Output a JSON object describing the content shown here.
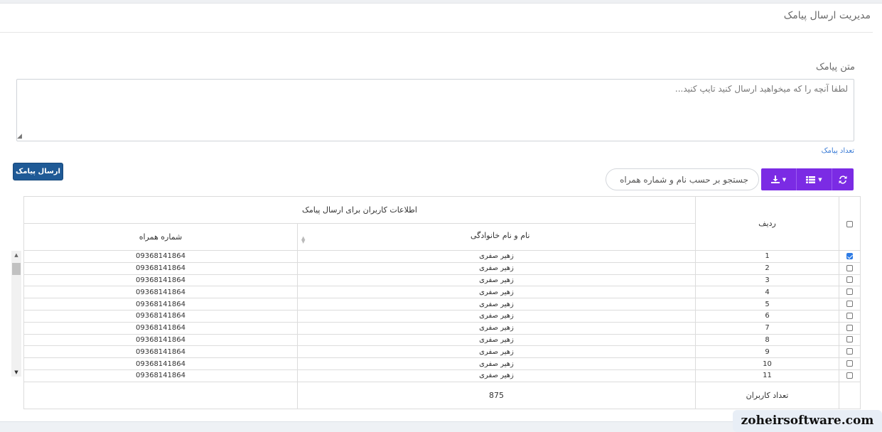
{
  "page": {
    "title": "مدیریت ارسال پیامک"
  },
  "message": {
    "label": "متن پیامک",
    "placeholder": "لطفا آنچه را که میخواهید ارسال کنید تایپ کنید...",
    "count_label": "تعداد پیامک",
    "send_label": "ارسال پیامک"
  },
  "search": {
    "placeholder": "جستجو بر حسب نام و شماره همراه"
  },
  "toolbar": {
    "icons": [
      "download-icon",
      "columns-icon",
      "refresh-icon"
    ],
    "color": "#7b2be4"
  },
  "table": {
    "group_header": "اطلاعات کاربران برای ارسال پیامک",
    "col_row": "ردیف",
    "col_name": "نام و نام خانوادگی",
    "col_phone": "شماره همراه",
    "rows": [
      {
        "index": "1",
        "name": "زهیر صفری",
        "phone": "09368141864",
        "checked": true
      },
      {
        "index": "2",
        "name": "زهیر صفری",
        "phone": "09368141864",
        "checked": false
      },
      {
        "index": "3",
        "name": "زهیر صفری",
        "phone": "09368141864",
        "checked": false
      },
      {
        "index": "4",
        "name": "زهیر صفری",
        "phone": "09368141864",
        "checked": false
      },
      {
        "index": "5",
        "name": "زهیر صفری",
        "phone": "09368141864",
        "checked": false
      },
      {
        "index": "6",
        "name": "زهیر صفری",
        "phone": "09368141864",
        "checked": false
      },
      {
        "index": "7",
        "name": "زهیر صفری",
        "phone": "09368141864",
        "checked": false
      },
      {
        "index": "8",
        "name": "زهیر صفری",
        "phone": "09368141864",
        "checked": false
      },
      {
        "index": "9",
        "name": "زهیر صفری",
        "phone": "09368141864",
        "checked": false
      },
      {
        "index": "10",
        "name": "زهیر صفری",
        "phone": "09368141864",
        "checked": false
      },
      {
        "index": "11",
        "name": "زهیر صفری",
        "phone": "09368141864",
        "checked": false
      }
    ],
    "footer_label": "تعداد کاربران",
    "footer_value": "875"
  },
  "watermark": "zoheirsoftware.com"
}
